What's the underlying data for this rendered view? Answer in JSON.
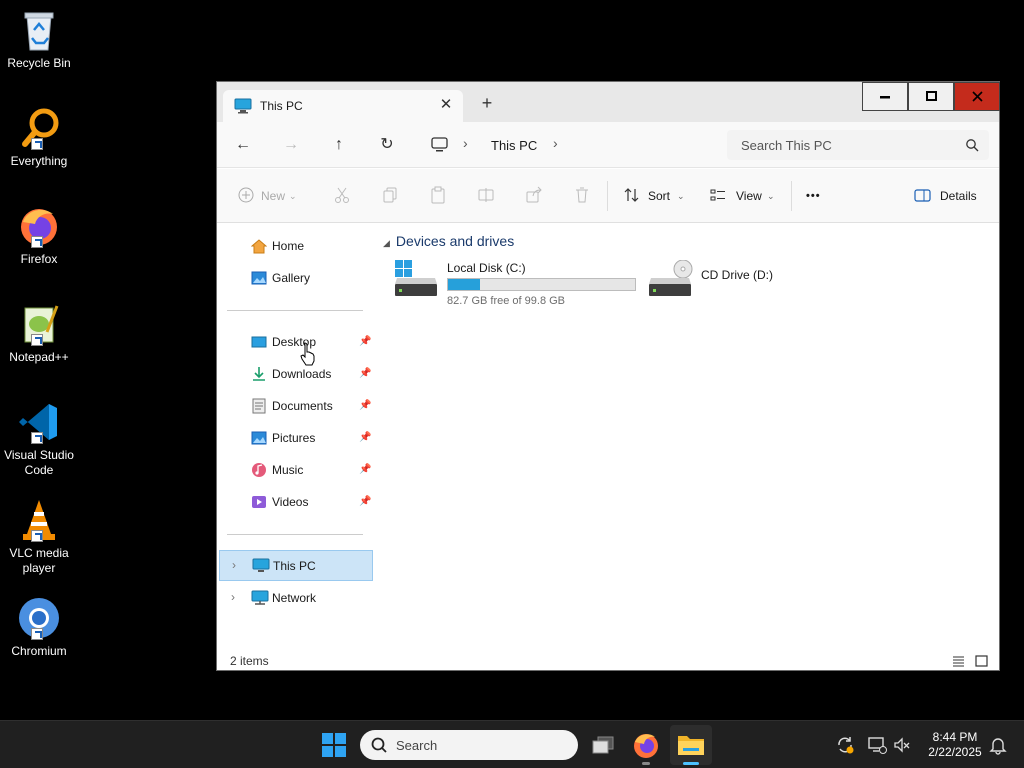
{
  "desktop": {
    "icons": [
      {
        "label": "Recycle Bin"
      },
      {
        "label": "Everything"
      },
      {
        "label": "Firefox"
      },
      {
        "label": "Notepad++"
      },
      {
        "label": "Visual Studio Code"
      },
      {
        "label": "VLC media player"
      },
      {
        "label": "Chromium"
      }
    ]
  },
  "window": {
    "tab_title": "This PC",
    "tab_close": "✕",
    "new_tab": "+",
    "nav": {
      "back": "←",
      "forward": "→",
      "up": "↑",
      "refresh": "↻"
    },
    "breadcrumb": {
      "sep": "›",
      "item": "This PC"
    },
    "search_placeholder": "Search This PC",
    "commands": {
      "new": "New",
      "sort": "Sort",
      "view": "View",
      "more": "•••",
      "details": "Details"
    },
    "sidebar": {
      "home": "Home",
      "gallery": "Gallery",
      "pinned": [
        {
          "label": "Desktop"
        },
        {
          "label": "Downloads"
        },
        {
          "label": "Documents"
        },
        {
          "label": "Pictures"
        },
        {
          "label": "Music"
        },
        {
          "label": "Videos"
        }
      ],
      "pin_glyph": "📌",
      "this_pc": "This PC",
      "network": "Network",
      "chevron": "›"
    },
    "content": {
      "group_title": "Devices and drives",
      "drives": [
        {
          "name": "Local Disk (C:)",
          "free_text": "82.7 GB free of 99.8 GB",
          "used_fraction": 0.171
        },
        {
          "name": "CD Drive (D:)"
        }
      ]
    },
    "status": {
      "item_count": "2 items"
    }
  },
  "taskbar": {
    "search_placeholder": "Search",
    "clock_time": "8:44 PM",
    "clock_date": "2/22/2025"
  },
  "colors": {
    "accent": "#0078d4",
    "drive_bar": "#26a0da",
    "close_button": "#c42b1c",
    "selection": "#cce4f7"
  }
}
